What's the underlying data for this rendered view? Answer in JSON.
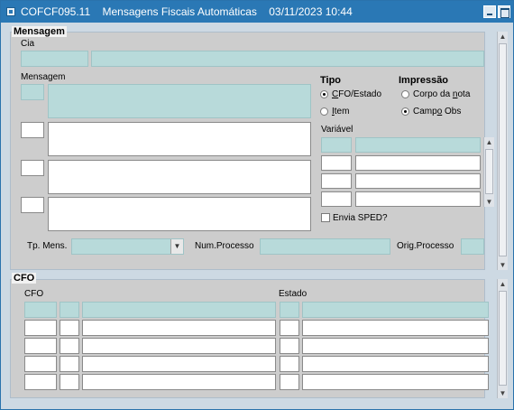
{
  "window": {
    "title": "COFCF095.11    Mensagens Fiscais Automáticas    03/11/2023 10:44"
  },
  "mensagem_section": {
    "title": "Mensagem",
    "cia_label": "Cia",
    "mensagem_label": "Mensagem",
    "tipo": {
      "label": "Tipo",
      "options": [
        {
          "prefix": "",
          "underline": "C",
          "suffix": "FO/Estado",
          "selected": true
        },
        {
          "prefix": "",
          "underline": "I",
          "suffix": "tem",
          "selected": false
        }
      ]
    },
    "impressao": {
      "label": "Impressão",
      "options": [
        {
          "prefix": "Corpo da ",
          "underline": "n",
          "suffix": "ota",
          "selected": false
        },
        {
          "prefix": "Camp",
          "underline": "o",
          "suffix": " Obs",
          "selected": true
        }
      ]
    },
    "variavel_label": "Variável",
    "envia_sped_label": "Envia SPED?",
    "envia_sped_checked": false,
    "tp_mens_label": "Tp. Mens.",
    "tp_mens_value": "",
    "num_processo_label": "Num.Processo",
    "num_processo_value": "",
    "orig_processo_label": "Orig.Processo",
    "orig_processo_value": ""
  },
  "cfo_section": {
    "title": "CFO",
    "cfo_label": "CFO",
    "estado_label": "Estado"
  },
  "icons": {
    "app": "oracle-forms-icon",
    "minimize": "minimize-icon",
    "maximize": "maximize-icon",
    "scroll_up": "arrow-up-icon",
    "scroll_down": "arrow-down-icon",
    "dropdown": "chevron-down-icon"
  },
  "colors": {
    "titlebar": "#2a78b5",
    "field_teal": "#b8dada",
    "panel": "#cdcdcd"
  }
}
